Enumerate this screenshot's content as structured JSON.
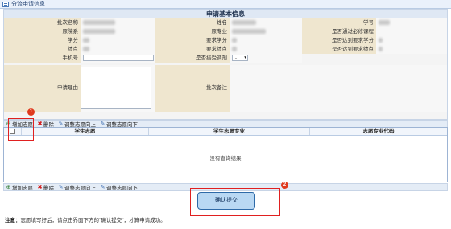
{
  "window": {
    "title": "分流申请信息"
  },
  "form": {
    "heading": "申请基本信息",
    "labels": {
      "batch_name": "批次名称",
      "name": "姓名",
      "student_id": "学号",
      "faculty": "原院系",
      "major": "原专业",
      "required_course": "是否通过必修课程",
      "credits": "学分",
      "required_credits": "要求学分",
      "credits_met": "是否达到要求学分",
      "gpa": "绩点",
      "required_gpa": "要求绩点",
      "gpa_met": "是否达到要求绩点",
      "phone": "手机号",
      "accept_adjust": "是否接受调剂",
      "reason": "申请理由",
      "batch_note": "批次备注"
    },
    "adjust_select_value": "..."
  },
  "toolbar": {
    "add": "增加志愿",
    "delete": "删除",
    "move_up": "调整志愿向上",
    "move_down": "调整志愿向下"
  },
  "table": {
    "columns": [
      "学生志愿",
      "学生志愿专业",
      "志愿专业代码"
    ],
    "empty_text": "没有查询结果"
  },
  "confirm_label": "确认提交",
  "badges": {
    "first": "1",
    "second": "2"
  },
  "note": {
    "prefix": "注意：",
    "text": "志愿填写好后，请点击界面下方的\"确认提交\"，才算申请成功。"
  }
}
